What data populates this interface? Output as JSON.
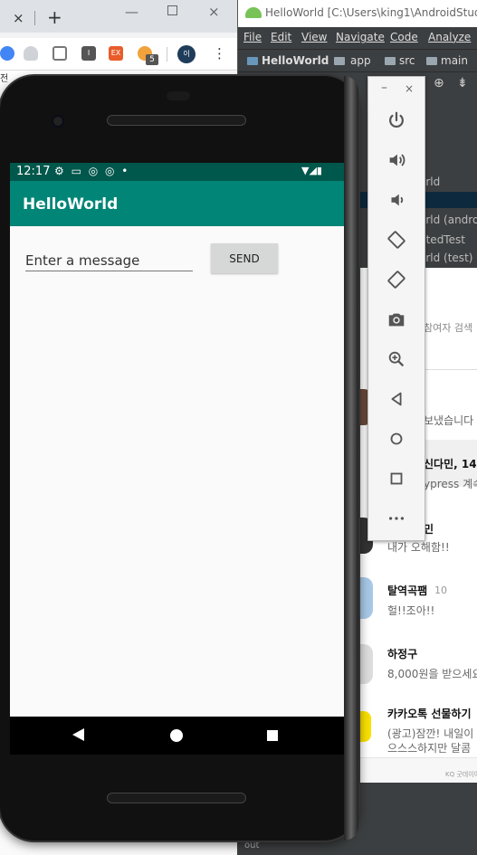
{
  "browser": {
    "tab_close": "×",
    "new_tab": "+",
    "window_min": "—",
    "window_close": "×",
    "profile_initial": "이",
    "ext_badge_count": "5",
    "menu_icon": "⋮",
    "strip_text": "전",
    "ext_ex_label": "EX",
    "ext_dark_label": "I"
  },
  "ide": {
    "title": "HelloWorld [C:\\Users\\king1\\AndroidStudio",
    "menu": [
      "File",
      "Edit",
      "View",
      "Navigate",
      "Code",
      "Analyze"
    ],
    "breadcrumb": [
      "HelloWorld",
      "app",
      "src",
      "main"
    ],
    "tree": [
      "orld",
      "orld (andro",
      "ntedTest",
      "orld (test)"
    ],
    "bottom_tab": "out"
  },
  "kakao": {
    "search_placeholder": "참여자 검색",
    "chats": [
      {
        "name": "",
        "message": "보냈습니다"
      },
      {
        "name": "신다민, 14",
        "message": "ypress 계속"
      },
      {
        "name": "민",
        "message": "내가 오해함!!"
      },
      {
        "name": "탈역곡팸",
        "count": "10",
        "message": "헐!!조아!!"
      },
      {
        "name": "하정구",
        "message": "8,000원을 받으세요"
      },
      {
        "name": "카카오톡 선물하기",
        "message": "(광고)잠깐! 내일이",
        "message2": "으스스하지만 달콤"
      }
    ],
    "footer": "KQ 굿데이어스"
  },
  "emulator": {
    "minimize": "–",
    "close": "×",
    "controls": [
      "power-icon",
      "volume-up-icon",
      "volume-down-icon",
      "rotate-left-icon",
      "rotate-right-icon",
      "camera-icon",
      "zoom-icon",
      "back-icon",
      "home-icon",
      "overview-icon",
      "more-icon"
    ]
  },
  "phone": {
    "status": {
      "time": "12:17",
      "icons": "⚙ ▭ ◎ ◎ •",
      "right": "▼◢▮"
    },
    "app_title": "HelloWorld",
    "message_placeholder": "Enter a message",
    "send_label": "SEND"
  }
}
